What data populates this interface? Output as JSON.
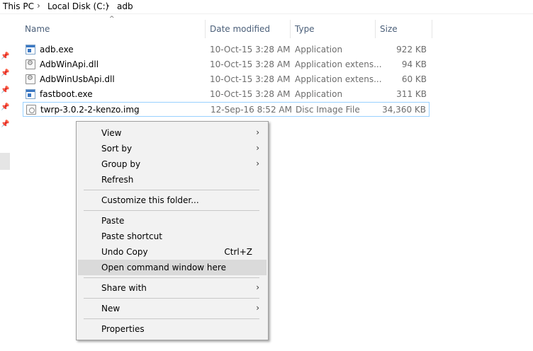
{
  "breadcrumb": {
    "items": [
      "This PC",
      "Local Disk (C:)",
      "adb"
    ],
    "separator": "›"
  },
  "columns": {
    "name": "Name",
    "date": "Date modified",
    "type": "Type",
    "size": "Size"
  },
  "files": [
    {
      "name": "adb.exe",
      "date": "10-Oct-15 3:28 AM",
      "type": "Application",
      "size": "922 KB",
      "icon": "exe-icon"
    },
    {
      "name": "AdbWinApi.dll",
      "date": "10-Oct-15 3:28 AM",
      "type": "Application extens...",
      "size": "94 KB",
      "icon": "dll-icon"
    },
    {
      "name": "AdbWinUsbApi.dll",
      "date": "10-Oct-15 3:28 AM",
      "type": "Application extens...",
      "size": "60 KB",
      "icon": "dll-icon"
    },
    {
      "name": "fastboot.exe",
      "date": "10-Oct-15 3:28 AM",
      "type": "Application",
      "size": "311 KB",
      "icon": "exe-icon"
    },
    {
      "name": "twrp-3.0.2-2-kenzo.img",
      "date": "12-Sep-16 8:52 AM",
      "type": "Disc Image File",
      "size": "34,360 KB",
      "icon": "disc-image-icon",
      "selected": true
    }
  ],
  "context_menu": {
    "view": "View",
    "sort_by": "Sort by",
    "group_by": "Group by",
    "refresh": "Refresh",
    "customize": "Customize this folder...",
    "paste": "Paste",
    "paste_shortcut": "Paste shortcut",
    "undo_copy": "Undo Copy",
    "undo_copy_shortcut": "Ctrl+Z",
    "open_cmd": "Open command window here",
    "share_with": "Share with",
    "new": "New",
    "properties": "Properties",
    "submenu_arrow": "›"
  },
  "colors": {
    "header_text": "#4c607a",
    "selection_border": "#99d1ff",
    "menu_bg": "#f2f2f2",
    "menu_hover": "#dadada"
  }
}
